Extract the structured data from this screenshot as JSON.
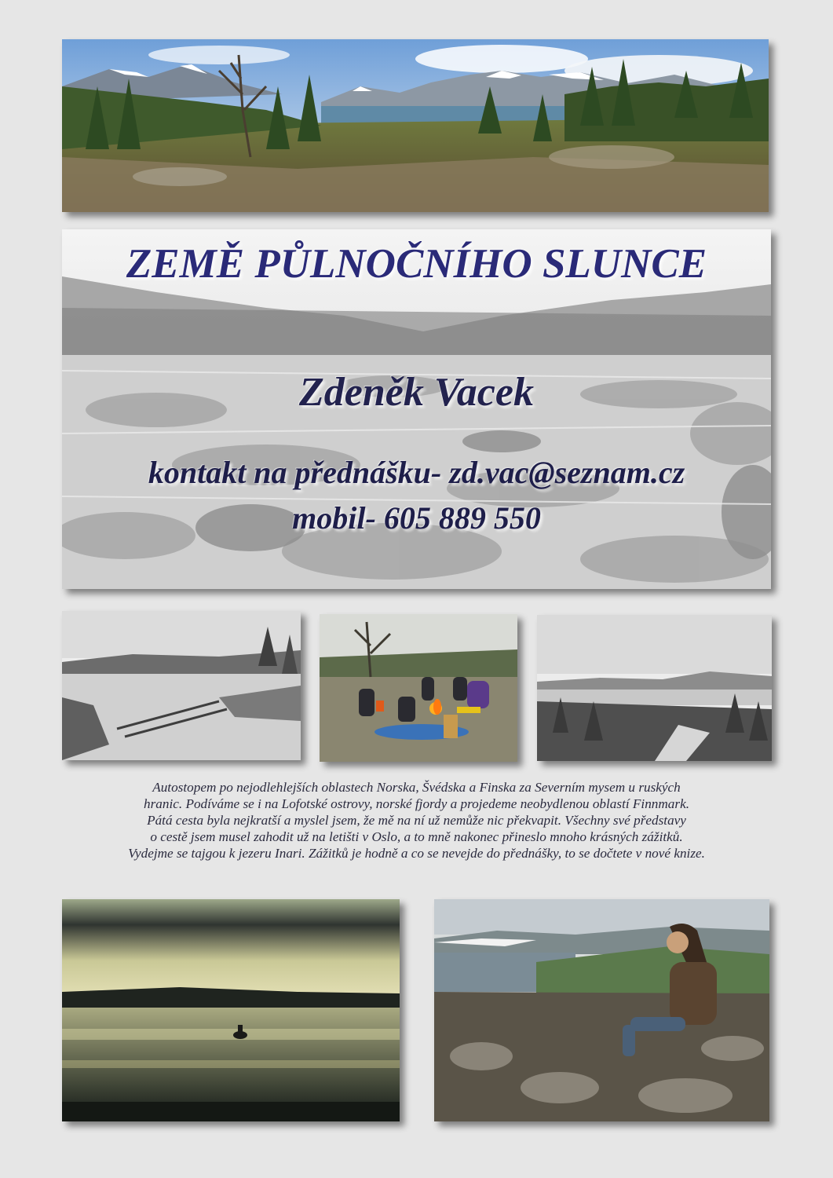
{
  "poster": {
    "title": "ZEMĚ PŮLNOČNÍHO SLUNCE",
    "author": "Zdeněk Vacek",
    "contact": "kontakt na přednášku- zd.vac@seznam.cz",
    "mobile": "mobil- 605 889 550",
    "description_lines": [
      "Autostopem po nejodlehlejších oblastech Norska, Švédska a Finska za Severním mysem u ruských",
      "hranic. Podíváme se i na Lofotské ostrovy, norské fjordy a projedeme neobydlenou oblastí Finnmark.",
      "Pátá cesta byla nejkratší a myslel jsem, že mě na ní už nemůže nic překvapit. Všechny své představy",
      "o cestě jsem musel zahodit už na letišti v Oslo, a to mně nakonec přineslo mnoho krásných zážitků.",
      "Vydejme se tajgou k jezeru Inari. Zážitků je hodně a co se nevejde do přednášky, to se dočtete v nové knize."
    ]
  },
  "colors": {
    "background": "#e6e6e6",
    "title": "#2a2a78",
    "text": "#1e1e4a"
  }
}
